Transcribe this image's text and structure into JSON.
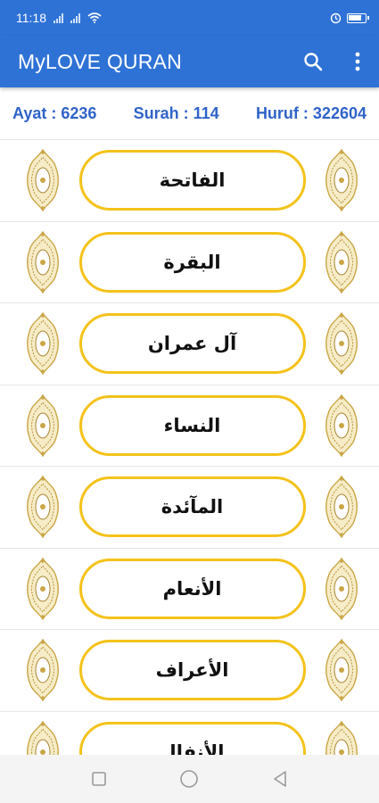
{
  "status_bar": {
    "time": "11:18"
  },
  "app_bar": {
    "title": "MyLOVE QURAN",
    "icons": [
      "search-icon",
      "more-vert-icon"
    ]
  },
  "stats": {
    "ayat": "Ayat : 6236",
    "surah": "Surah : 114",
    "huruf": "Huruf : 322604"
  },
  "surahs": [
    {
      "name": "الفاتحة"
    },
    {
      "name": "البقرة"
    },
    {
      "name": "آل عمران"
    },
    {
      "name": "النساء"
    },
    {
      "name": "المآئدة"
    },
    {
      "name": "الأنعام"
    },
    {
      "name": "الأعراف"
    },
    {
      "name": "الأنفال"
    }
  ],
  "colors": {
    "primary": "#2f72d6",
    "stats_text": "#2f63c8",
    "button_border": "#f4c21a"
  },
  "nav": {
    "icons": [
      "recent-apps-icon",
      "home-icon",
      "back-icon"
    ]
  }
}
